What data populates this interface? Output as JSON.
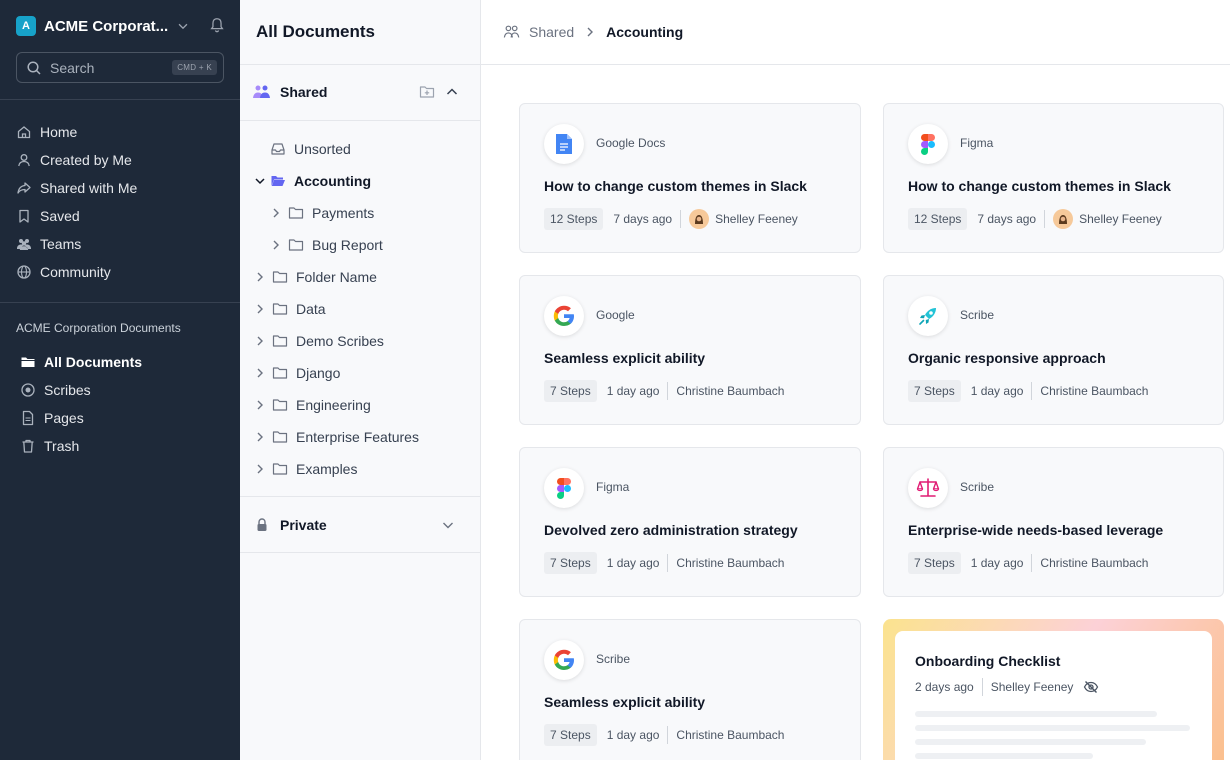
{
  "workspace": {
    "initial": "A",
    "name": "ACME Corporat...",
    "accent": "#17a2c9"
  },
  "search": {
    "placeholder": "Search",
    "shortcut": "CMD + K"
  },
  "nav": {
    "items": [
      {
        "label": "Home",
        "icon": "home-icon"
      },
      {
        "label": "Created by Me",
        "icon": "user-icon"
      },
      {
        "label": "Shared with Me",
        "icon": "share-icon"
      },
      {
        "label": "Saved",
        "icon": "bookmark-icon"
      },
      {
        "label": "Teams",
        "icon": "users-icon"
      },
      {
        "label": "Community",
        "icon": "globe-icon"
      }
    ],
    "section_title": "ACME Corporation Documents",
    "doc_items": [
      {
        "label": "All Documents",
        "icon": "folder-icon",
        "active": true
      },
      {
        "label": "Scribes",
        "icon": "record-icon"
      },
      {
        "label": "Pages",
        "icon": "page-icon"
      },
      {
        "label": "Trash",
        "icon": "trash-icon"
      }
    ]
  },
  "panel": {
    "title": "All Documents",
    "shared_label": "Shared",
    "private_label": "Private",
    "tree": [
      {
        "label": "Unsorted",
        "icon": "inbox-icon"
      },
      {
        "label": "Accounting",
        "icon": "folder-open-icon",
        "expanded": true,
        "selected": true
      },
      {
        "label": "Payments",
        "icon": "folder-icon"
      },
      {
        "label": "Bug Report",
        "icon": "folder-icon"
      },
      {
        "label": "Folder Name",
        "icon": "folder-icon"
      },
      {
        "label": "Data",
        "icon": "folder-icon"
      },
      {
        "label": "Demo Scribes",
        "icon": "folder-icon"
      },
      {
        "label": "Django",
        "icon": "folder-icon"
      },
      {
        "label": "Engineering",
        "icon": "folder-icon"
      },
      {
        "label": "Enterprise Features",
        "icon": "folder-icon"
      },
      {
        "label": "Examples",
        "icon": "folder-icon"
      }
    ]
  },
  "breadcrumb": {
    "parent": "Shared",
    "current": "Accounting"
  },
  "cards": [
    {
      "source": "Google Docs",
      "logo": "google-docs-icon",
      "title": "How to change custom themes in Slack",
      "steps": "12 Steps",
      "ago": "7 days ago",
      "author": "Shelley Feeney",
      "has_avatar": true
    },
    {
      "source": "Figma",
      "logo": "figma-icon",
      "title": "How to change custom themes in Slack",
      "steps": "12 Steps",
      "ago": "7 days ago",
      "author": "Shelley Feeney",
      "has_avatar": true
    },
    {
      "source": "Google",
      "logo": "google-icon",
      "title": "Seamless explicit ability",
      "steps": "7 Steps",
      "ago": "1 day ago",
      "author": "Christine Baumbach"
    },
    {
      "source": "Scribe",
      "logo": "rocket-icon",
      "title": "Organic responsive approach",
      "steps": "7 Steps",
      "ago": "1 day ago",
      "author": "Christine Baumbach"
    },
    {
      "source": "Figma",
      "logo": "figma-icon",
      "title": "Devolved zero administration strategy",
      "steps": "7 Steps",
      "ago": "1 day ago",
      "author": "Christine Baumbach"
    },
    {
      "source": "Scribe",
      "logo": "scales-icon",
      "title": "Enterprise-wide needs-based leverage",
      "steps": "7 Steps",
      "ago": "1 day ago",
      "author": "Christine Baumbach"
    },
    {
      "source": "Scribe",
      "logo": "google-icon",
      "title": "Seamless explicit ability",
      "steps": "7 Steps",
      "ago": "1 day ago",
      "author": "Christine Baumbach"
    }
  ],
  "onboarding": {
    "title": "Onboarding Checklist",
    "ago": "2 days ago",
    "author": "Shelley Feeney",
    "icon": "eye-off-icon"
  }
}
